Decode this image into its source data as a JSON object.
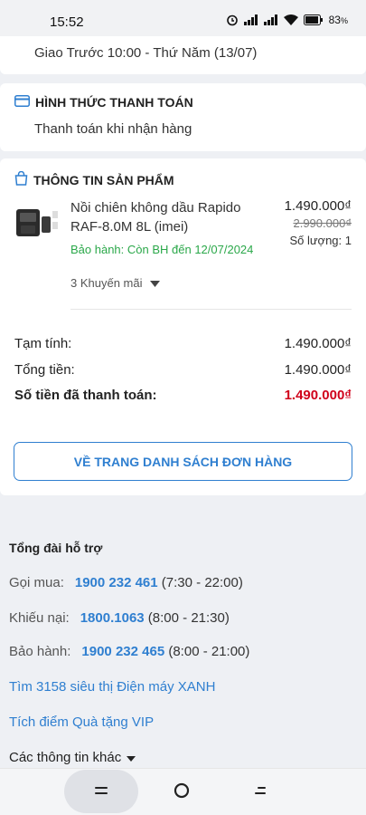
{
  "status_bar": {
    "time": "15:52",
    "battery": "83",
    "battery_unit": "%"
  },
  "delivery": {
    "text": "Giao Trước 10:00 - Thứ Năm (13/07)"
  },
  "payment": {
    "heading": "HÌNH THỨC THANH TOÁN",
    "value": "Thanh toán khi nhận hàng"
  },
  "product_section": {
    "heading": "THÔNG TIN SẢN PHẨM",
    "product": {
      "name": "Nồi chiên không dầu Rapido RAF-8.0M 8L (imei)",
      "warranty": "Bảo hành: Còn BH đến 12/07/2024",
      "price": "1.490.000₫",
      "old_price": "2.990.000₫",
      "quantity": "Số lượng: 1"
    },
    "promo": "3 Khuyến mãi"
  },
  "summary": {
    "subtotal_label": "Tạm tính:",
    "subtotal_value": "1.490.000₫",
    "total_label": "Tổng tiền:",
    "total_value": "1.490.000₫",
    "paid_label": "Số tiền đã thanh toán:",
    "paid_value": "1.490.000₫"
  },
  "orders_button": "VỀ TRANG DANH SÁCH ĐƠN HÀNG",
  "support": {
    "title": "Tổng đài hỗ trợ",
    "lines": [
      {
        "label": "Gọi mua:",
        "phone": "1900 232 461",
        "hours": "(7:30 - 22:00)"
      },
      {
        "label": "Khiếu nại:",
        "phone": "1800.1063",
        "hours": "(8:00 - 21:30)"
      },
      {
        "label": "Bảo hành:",
        "phone": "1900 232 465",
        "hours": "(8:00 - 21:00)"
      }
    ],
    "stores_link": "Tìm 3158 siêu thị Điện máy XANH",
    "vip_link": "Tích điểm Quà tặng VIP",
    "more": "Các thông tin khác"
  },
  "colors": {
    "accent": "#2f7fd0",
    "price_red": "#d0021b",
    "warranty_green": "#2ba84a"
  }
}
